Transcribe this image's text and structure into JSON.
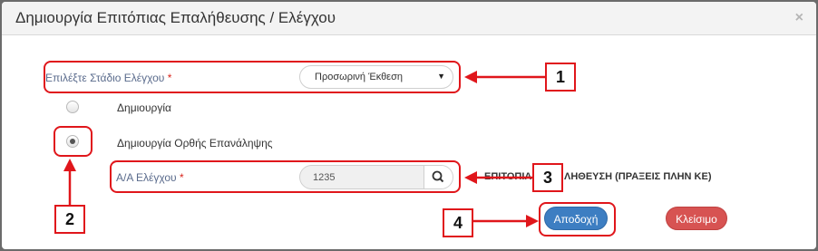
{
  "dialog": {
    "title": "Δημιουργία Επιτόπιας Επαλήθευσης / Ελέγχου",
    "close_glyph": "×"
  },
  "stage": {
    "label": "Επιλέξτε Στάδιο Ελέγχου",
    "required_mark": "*",
    "selected": "Προσωρινή Έκθεση",
    "caret": "▼"
  },
  "radios": [
    {
      "label": "Δημιουργία",
      "checked": false
    },
    {
      "label": "Δημιουργία Ορθής Επανάληψης",
      "checked": true
    }
  ],
  "check_id": {
    "label": "Α/Α Ελέγχου",
    "required_mark": "*",
    "value": "1235",
    "background_text_left": "ΕΠΙΤΟΠΙΑ",
    "background_text_right": "ΛΗΘΕΥΣΗ (ΠΡΑΞΕΙΣ ΠΛΗΝ ΚΕ)"
  },
  "buttons": {
    "accept": "Αποδοχή",
    "close": "Κλείσιμο"
  },
  "annotations": {
    "numbers": [
      "1",
      "2",
      "3",
      "4"
    ],
    "color": "#e0161b"
  },
  "icons": {
    "search": "search-icon",
    "close": "close-icon",
    "dropdown": "chevron-down-icon"
  }
}
